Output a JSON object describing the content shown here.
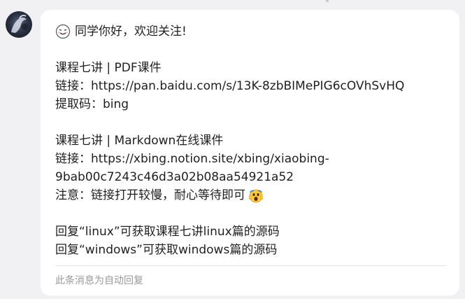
{
  "message": {
    "greeting": "同学你好，欢迎关注!",
    "pdf": {
      "title": "课程七讲 | PDF课件",
      "link_line": "链接：https://pan.baidu.com/s/13K-8zbBIMePIG6cOVhSvHQ",
      "code_line": "提取码：bing"
    },
    "markdown": {
      "title": "课程七讲 | Markdown在线课件",
      "link_line_1": "链接：https://xbing.notion.site/xbing/xiaobing-",
      "link_line_2": "9bab00c7243c46d3a02b08aa54921a52",
      "note": "注意：链接打开较慢，耐心等待即可"
    },
    "reply_linux": "回复“linux”可获取课程七讲linux篇的源码",
    "reply_windows": "回复“windows”可获取windows篇的源码"
  },
  "footer": {
    "auto_reply_note": "此条消息为自动回复"
  },
  "icons": {
    "greeting_emoji": "smiling-face-emoji",
    "note_emoji": "screaming-face-emoji"
  }
}
